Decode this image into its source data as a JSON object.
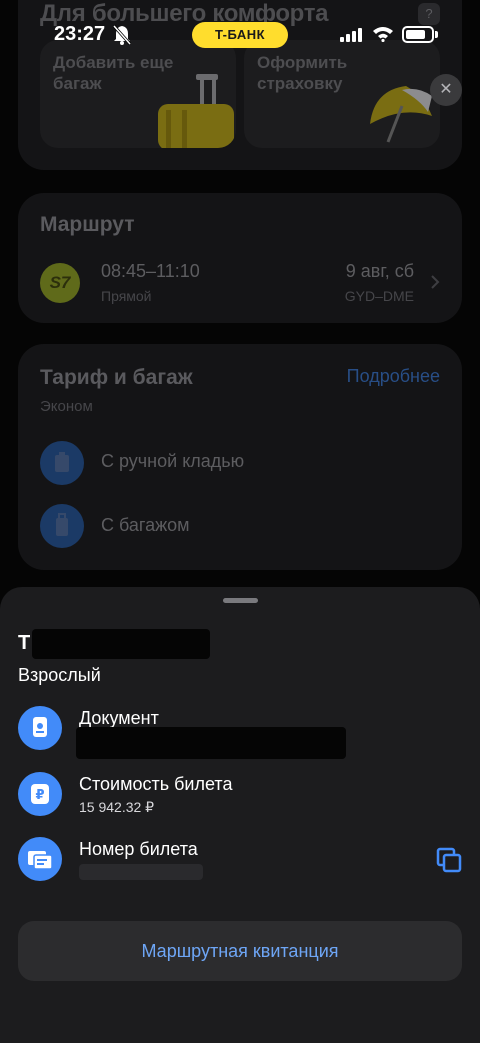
{
  "status_bar": {
    "time": "23:27",
    "carrier_badge": "T-БАНК"
  },
  "comfort": {
    "title": "Для большего комфорта",
    "help": "?",
    "tiles": [
      {
        "line1": "Добавить еще",
        "line2": "багаж"
      },
      {
        "line1": "Оформить",
        "line2": "страховку"
      }
    ],
    "close": "✕"
  },
  "route": {
    "title": "Маршрут",
    "airline_logo": "S7",
    "times": "08:45–11:10",
    "flight_type": "Прямой",
    "date": "9 авг, сб",
    "airports": "GYD–DME"
  },
  "tariff": {
    "title": "Тариф и багаж",
    "more_link": "Подробнее",
    "class": "Эконом",
    "items": [
      {
        "label": "С ручной кладью",
        "icon": "carry-on-icon"
      },
      {
        "label": "С багажом",
        "icon": "luggage-icon"
      }
    ]
  },
  "sheet": {
    "passenger_initial": "Т",
    "passenger_type": "Взрослый",
    "rows": [
      {
        "label": "Документ",
        "value": "",
        "icon": "passport-icon"
      },
      {
        "label": "Стоимость билета",
        "value": "15 942.32 ₽",
        "icon": "ruble-icon"
      },
      {
        "label": "Номер билета",
        "value": "",
        "icon": "ticket-icon"
      }
    ],
    "receipt_button": "Маршрутная квитанция"
  },
  "colors": {
    "accent": "#428bf9",
    "bank_yellow": "#ffdd2d",
    "sheet_bg": "#1c1c1e",
    "link": "#6ea6f6"
  }
}
